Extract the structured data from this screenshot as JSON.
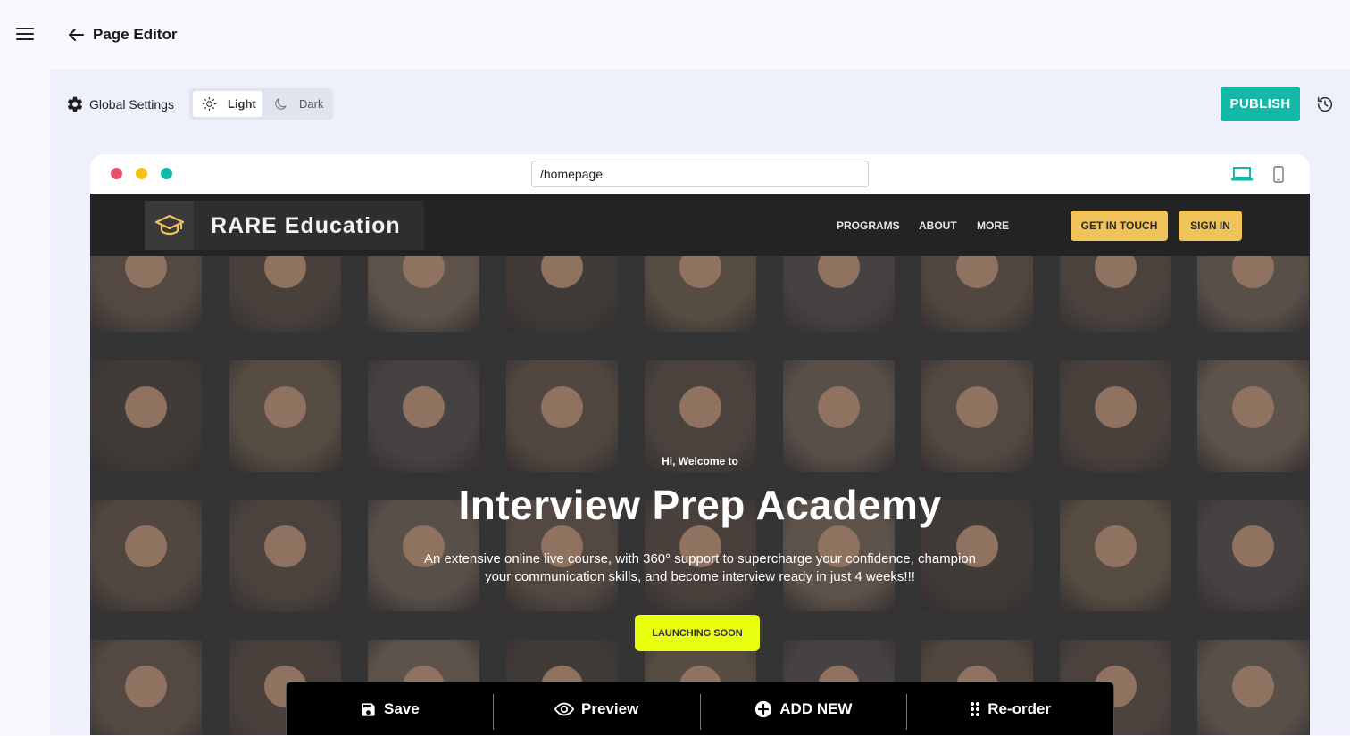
{
  "header": {
    "title": "Page Editor"
  },
  "toolbar_top": {
    "global_settings_label": "Global Settings",
    "theme": {
      "light_label": "Light",
      "dark_label": "Dark",
      "selected": "Light"
    },
    "publish_label": "PUBLISH"
  },
  "colors": {
    "accent": "#14b8a6",
    "brand_yellow": "#f0c25a",
    "cta_yellow": "#e8ff10",
    "dot_red": "#e0556b",
    "dot_yellow": "#f2c318",
    "dot_green": "#14b8a6"
  },
  "browser": {
    "url": "/homepage"
  },
  "site": {
    "logo_text": "RARE Education",
    "nav": {
      "links": [
        "PROGRAMS",
        "ABOUT",
        "MORE"
      ],
      "get_in_touch": "GET IN TOUCH",
      "sign_in": "SIGN IN"
    },
    "hero": {
      "kicker": "Hi, Welcome to",
      "title": "Interview Prep Academy",
      "subtitle": "An extensive online live course, with 360° support to supercharge your confidence, champion your communication skills, and become interview ready in just 4 weeks!!!",
      "cta": "LAUNCHING SOON"
    }
  },
  "bottom_toolbar": {
    "save": "Save",
    "preview": "Preview",
    "add_new": "ADD NEW",
    "reorder": "Re-order"
  },
  "icons": [
    "menu-icon",
    "back-arrow-icon",
    "gear-icon",
    "sun-icon",
    "moon-icon",
    "history-icon",
    "laptop-icon",
    "phone-icon",
    "graduation-cap-icon",
    "save-icon",
    "eye-icon",
    "plus-circle-icon",
    "drag-dots-icon"
  ]
}
